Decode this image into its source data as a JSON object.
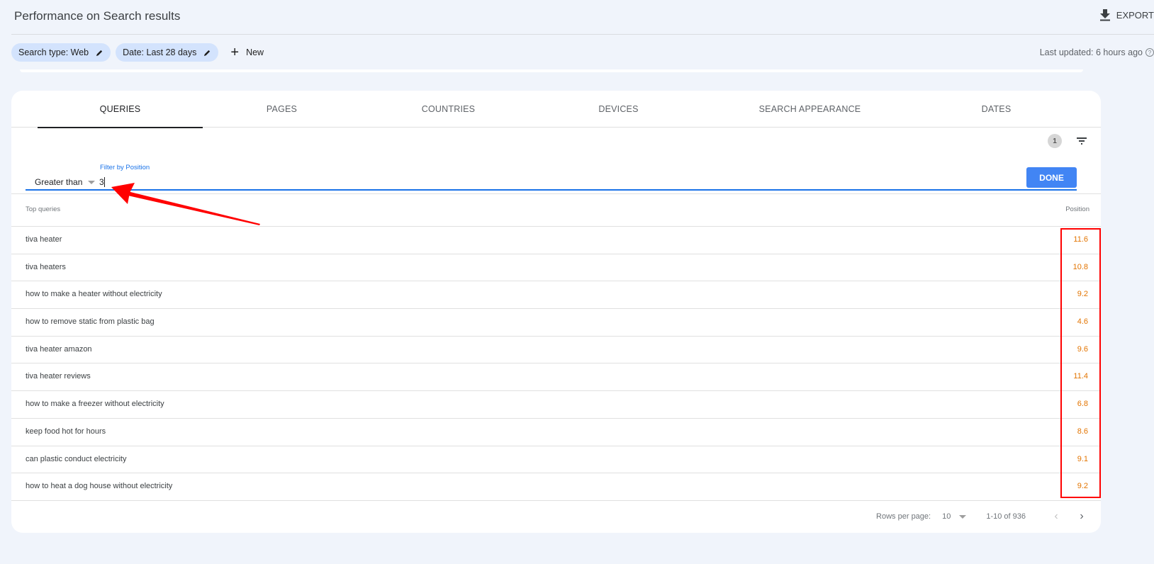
{
  "header": {
    "title": "Performance on Search results",
    "export_label": "EXPORT",
    "last_updated": "Last updated: 6 hours ago"
  },
  "filters": {
    "chips": [
      {
        "label": "Search type: Web"
      },
      {
        "label": "Date: Last 28 days"
      }
    ],
    "new_label": "New"
  },
  "tabs": [
    {
      "label": "QUERIES",
      "active": true
    },
    {
      "label": "PAGES",
      "active": false
    },
    {
      "label": "COUNTRIES",
      "active": false
    },
    {
      "label": "DEVICES",
      "active": false
    },
    {
      "label": "SEARCH APPEARANCE",
      "active": false
    },
    {
      "label": "DATES",
      "active": false
    }
  ],
  "table_filter": {
    "active_count": "1",
    "field_label": "Filter by Position",
    "operator": "Greater than",
    "value": "3",
    "done_label": "DONE"
  },
  "table": {
    "columns": {
      "query": "Top queries",
      "position": "Position"
    },
    "rows": [
      {
        "query": "tiva heater",
        "position": "11.6"
      },
      {
        "query": "tiva heaters",
        "position": "10.8"
      },
      {
        "query": "how to make a heater without electricity",
        "position": "9.2"
      },
      {
        "query": "how to remove static from plastic bag",
        "position": "4.6"
      },
      {
        "query": "tiva heater amazon",
        "position": "9.6"
      },
      {
        "query": "tiva heater reviews",
        "position": "11.4"
      },
      {
        "query": "how to make a freezer without electricity",
        "position": "6.8"
      },
      {
        "query": "keep food hot for hours",
        "position": "8.6"
      },
      {
        "query": "can plastic conduct electricity",
        "position": "9.1"
      },
      {
        "query": "how to heat a dog house without electricity",
        "position": "9.2"
      }
    ]
  },
  "pagination": {
    "rows_per_page_label": "Rows per page:",
    "rows_per_page": "10",
    "range": "1-10 of 936"
  },
  "colors": {
    "accent": "#1a73e8",
    "done_button": "#4285f4",
    "position_value": "#e37400",
    "annotation": "#ff0000",
    "chip": "#d3e3fd"
  }
}
